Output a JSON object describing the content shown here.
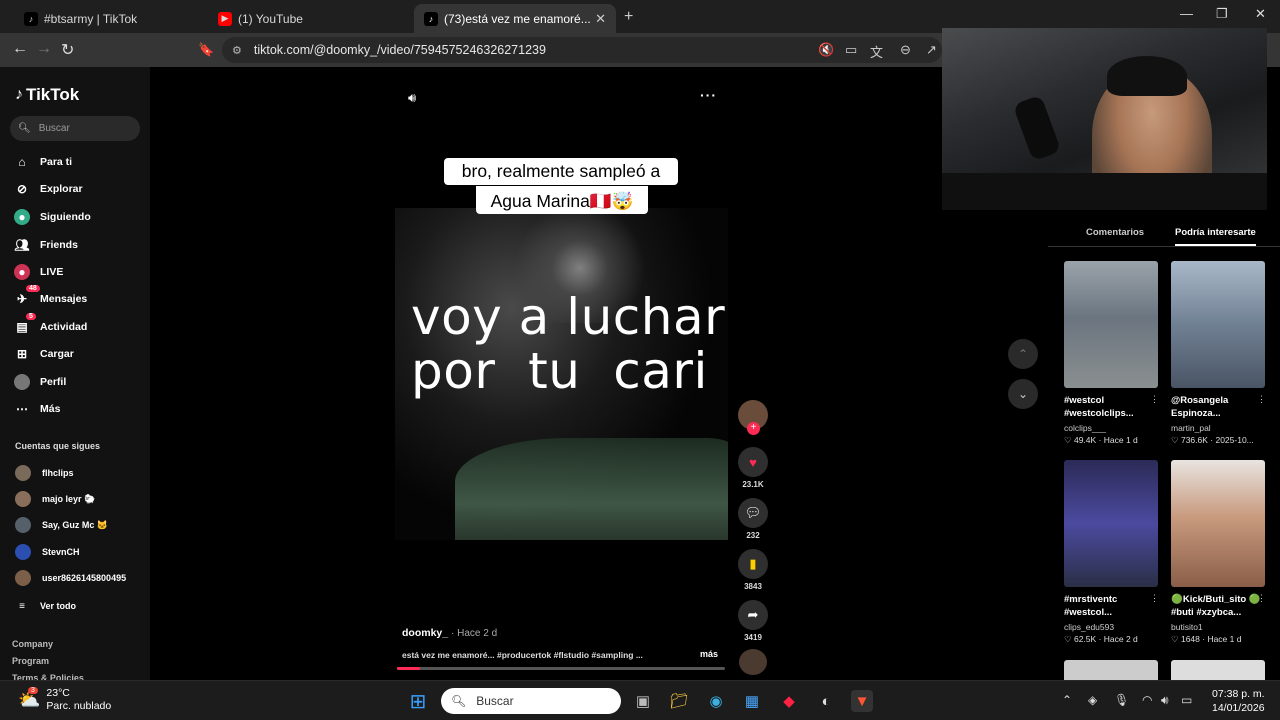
{
  "browser": {
    "tabs": [
      {
        "label": "#btsarmy | TikTok",
        "active": false
      },
      {
        "label": "(1) YouTube",
        "active": false
      },
      {
        "label": "(73)está vez me enamoré...",
        "active": true
      }
    ],
    "url": "tiktok.com/@doomky_/video/7594575246326271239"
  },
  "sidebar": {
    "logo": "TikTok",
    "search_placeholder": "Buscar",
    "nav": [
      {
        "label": "Para ti",
        "icon": "home-icon"
      },
      {
        "label": "Explorar",
        "icon": "compass-icon"
      },
      {
        "label": "Siguiendo",
        "icon": "following-icon"
      },
      {
        "label": "Friends",
        "icon": "friends-icon"
      },
      {
        "label": "LIVE",
        "icon": "live-icon"
      },
      {
        "label": "Mensajes",
        "icon": "messages-icon",
        "badge": "48"
      },
      {
        "label": "Actividad",
        "icon": "activity-icon",
        "badge": "5"
      },
      {
        "label": "Cargar",
        "icon": "upload-icon"
      },
      {
        "label": "Perfil",
        "icon": "profile-icon"
      },
      {
        "label": "Más",
        "icon": "more-icon"
      }
    ],
    "following_title": "Cuentas que sigues",
    "accounts": [
      "flhclips",
      "majo leyr 🐑",
      "Say, Guz Mc 🐱",
      "StevnCH",
      "user8626145800495"
    ],
    "see_all": "Ver todo",
    "footer": [
      "Company",
      "Program",
      "Terms & Policies"
    ]
  },
  "video": {
    "caption_line1": "bro, realmente sampleó a",
    "caption_line2": "Agua Marina🇵🇪🤯",
    "overlay_text": "voy a luchar\npor  tu  cari",
    "author": "doomky_",
    "ago": "· Hace 2 d",
    "description": "está vez me enamoré... #producertok #flstudio #sampling ...",
    "more": "más",
    "progress": 0.07,
    "likes": "23.1K",
    "comments": "232",
    "saves": "3843",
    "shares": "3419"
  },
  "right_panel": {
    "tabs": [
      "Comentarios",
      "Podría interesarte"
    ],
    "cards": [
      {
        "title": "#westcol #westcolclips...",
        "user": "colclips___",
        "meta": "♡ 49.4K · Hace 1 d",
        "color": "#7d8a96"
      },
      {
        "title": "@Rosangela Espinoza...",
        "user": "martin_pal",
        "meta": "♡ 736.6K · 2025-10...",
        "color": "#8b9fb4"
      },
      {
        "title": "#mrstiventc #westcol...",
        "user": "clips_edu593",
        "meta": "♡ 62.5K · Hace 2 d",
        "color": "#3d3b6e"
      },
      {
        "title": "🟢Kick/Buti_sito 🟢#buti #xzybca...",
        "user": "butisito1",
        "meta": "♡ 1648 · Hace 1 d",
        "color": "#b07a62"
      }
    ]
  },
  "taskbar": {
    "temp": "23°C",
    "weather": "Parc. nublado",
    "weather_badge": "3",
    "search": "Buscar",
    "time": "07:38 p. m.",
    "date": "14/01/2026"
  }
}
